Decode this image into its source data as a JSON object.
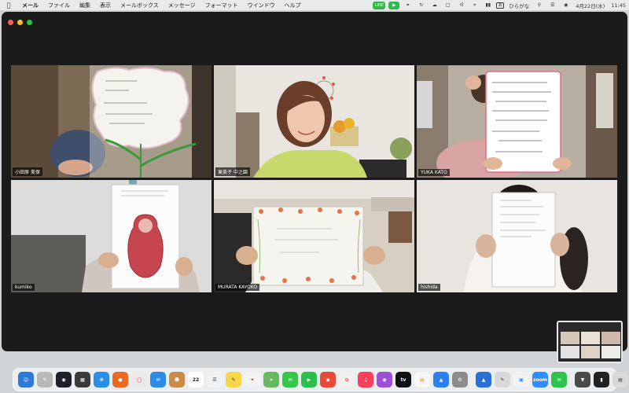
{
  "menubar": {
    "apple": "",
    "items": [
      "メール",
      "ファイル",
      "編集",
      "表示",
      "メールボックス",
      "メッセージ",
      "フォーマット",
      "ウインドウ",
      "ヘルプ"
    ],
    "status_line": "LINE",
    "input_method_label": "あ",
    "input_method": "ひらがな",
    "date": "4月22日(水)",
    "time": "11:45"
  },
  "participants": [
    {
      "name": "小田原 美保"
    },
    {
      "name": "東美子 中之園"
    },
    {
      "name": "YUKA KATO"
    },
    {
      "name": "kumiko"
    },
    {
      "name": "MURATA KAYOKO"
    },
    {
      "name": "hishida"
    }
  ],
  "dock": {
    "calendar_day": "22",
    "zoom_label": "zoom",
    "appletv_label": "tv"
  },
  "colors": {
    "active_speaker": "#3ad14a",
    "window_bg": "#1b1b1b"
  }
}
